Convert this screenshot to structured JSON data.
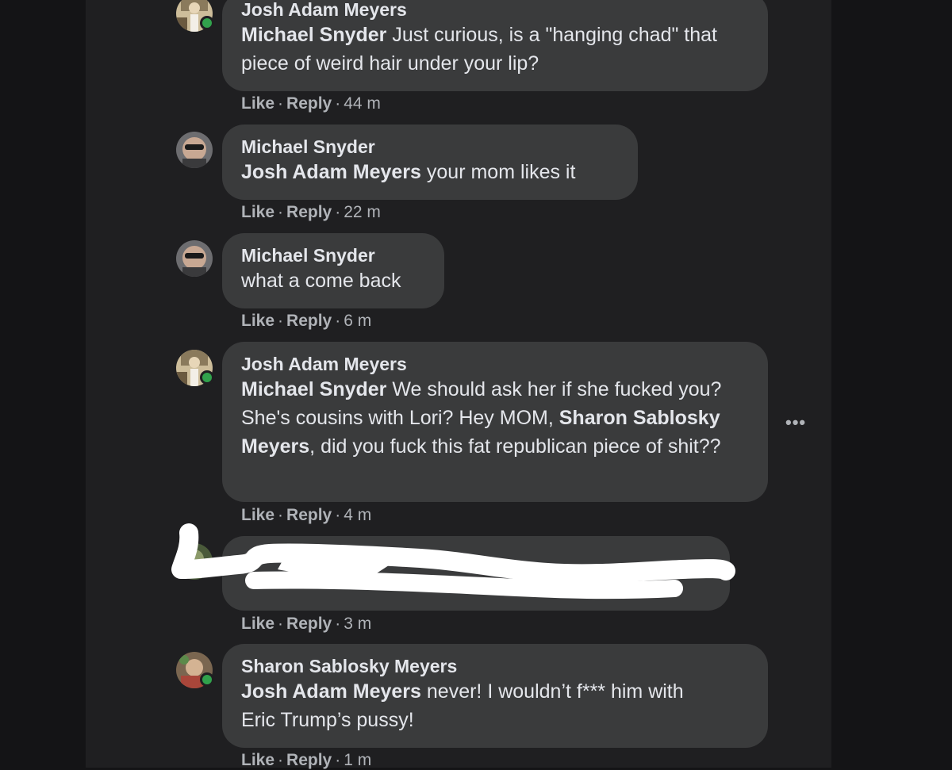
{
  "comments": [
    {
      "author": "Josh Adam Meyers",
      "mention": "Michael Snyder",
      "text": " Just curious, is a \"hanging chad\" that piece of weird hair under your lip?",
      "like": "Like",
      "reply": "Reply",
      "time": "44 m"
    },
    {
      "author": "Michael Snyder",
      "mention": "Josh Adam Meyers",
      "text": " your mom likes it",
      "like": "Like",
      "reply": "Reply",
      "time": "22 m"
    },
    {
      "author": "Michael Snyder",
      "text": "what a come back",
      "like": "Like",
      "reply": "Reply",
      "time": "6 m"
    },
    {
      "author": "Josh Adam Meyers",
      "mention": "Michael Snyder",
      "text1": " We should ask her if she fucked you? She's cousins with Lori? Hey MOM, ",
      "mention2": "Sharon Sablosky Meyers",
      "text2": ", did you fuck this fat republican piece of shit??",
      "like": "Like",
      "reply": "Reply",
      "time": "4 m"
    },
    {
      "like": "Like",
      "reply": "Reply",
      "time": "3 m"
    },
    {
      "author": "Sharon Sablosky Meyers",
      "mention": "Josh Adam Meyers",
      "text": " never! I wouldn’t f*** him with Eric Trump’s pussy!",
      "like": "Like",
      "reply": "Reply",
      "time": "1 m"
    }
  ],
  "more_options": "•••",
  "colors": {
    "background": "#141416",
    "panel": "#1f1f21",
    "bubble": "#3a3b3c",
    "text": "#e4e6eb",
    "meta": "#b0b3b8",
    "online": "#31a24c",
    "redaction": "#ffffff"
  },
  "icons": [
    "avatar-josh",
    "avatar-michael",
    "avatar-sharon",
    "online-status-dot",
    "more-options-icon"
  ]
}
